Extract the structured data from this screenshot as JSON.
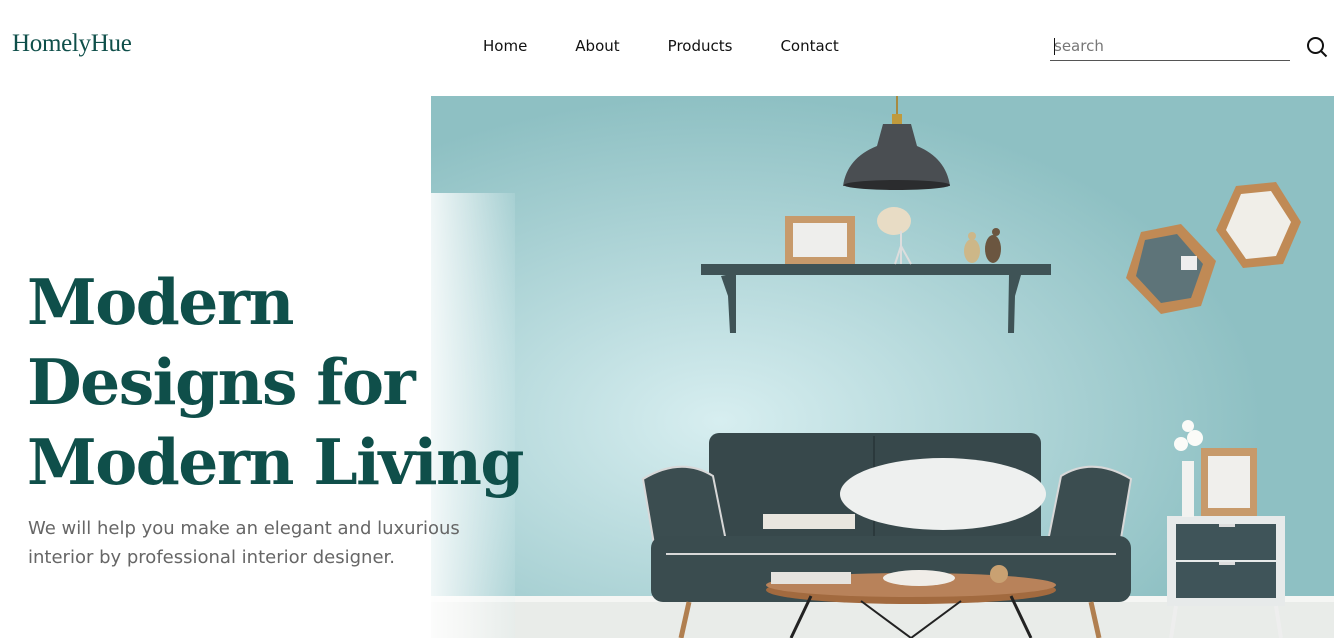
{
  "brand": {
    "name": "HomelyHue",
    "color": "#0f4f4a"
  },
  "nav": {
    "items": [
      {
        "label": "Home"
      },
      {
        "label": "About"
      },
      {
        "label": "Products"
      },
      {
        "label": "Contact"
      }
    ]
  },
  "search": {
    "placeholder": "search",
    "icon": "search-icon"
  },
  "hero": {
    "headline": [
      "Modern",
      "Designs for",
      "Modern Living"
    ],
    "subtext_lines": [
      "We will help you make an elegant and luxurious",
      "interior by professional interior designer."
    ]
  },
  "colors": {
    "wall": "#8fc1c4",
    "sofa": "#37484b",
    "accent": "#0f4f4a"
  }
}
